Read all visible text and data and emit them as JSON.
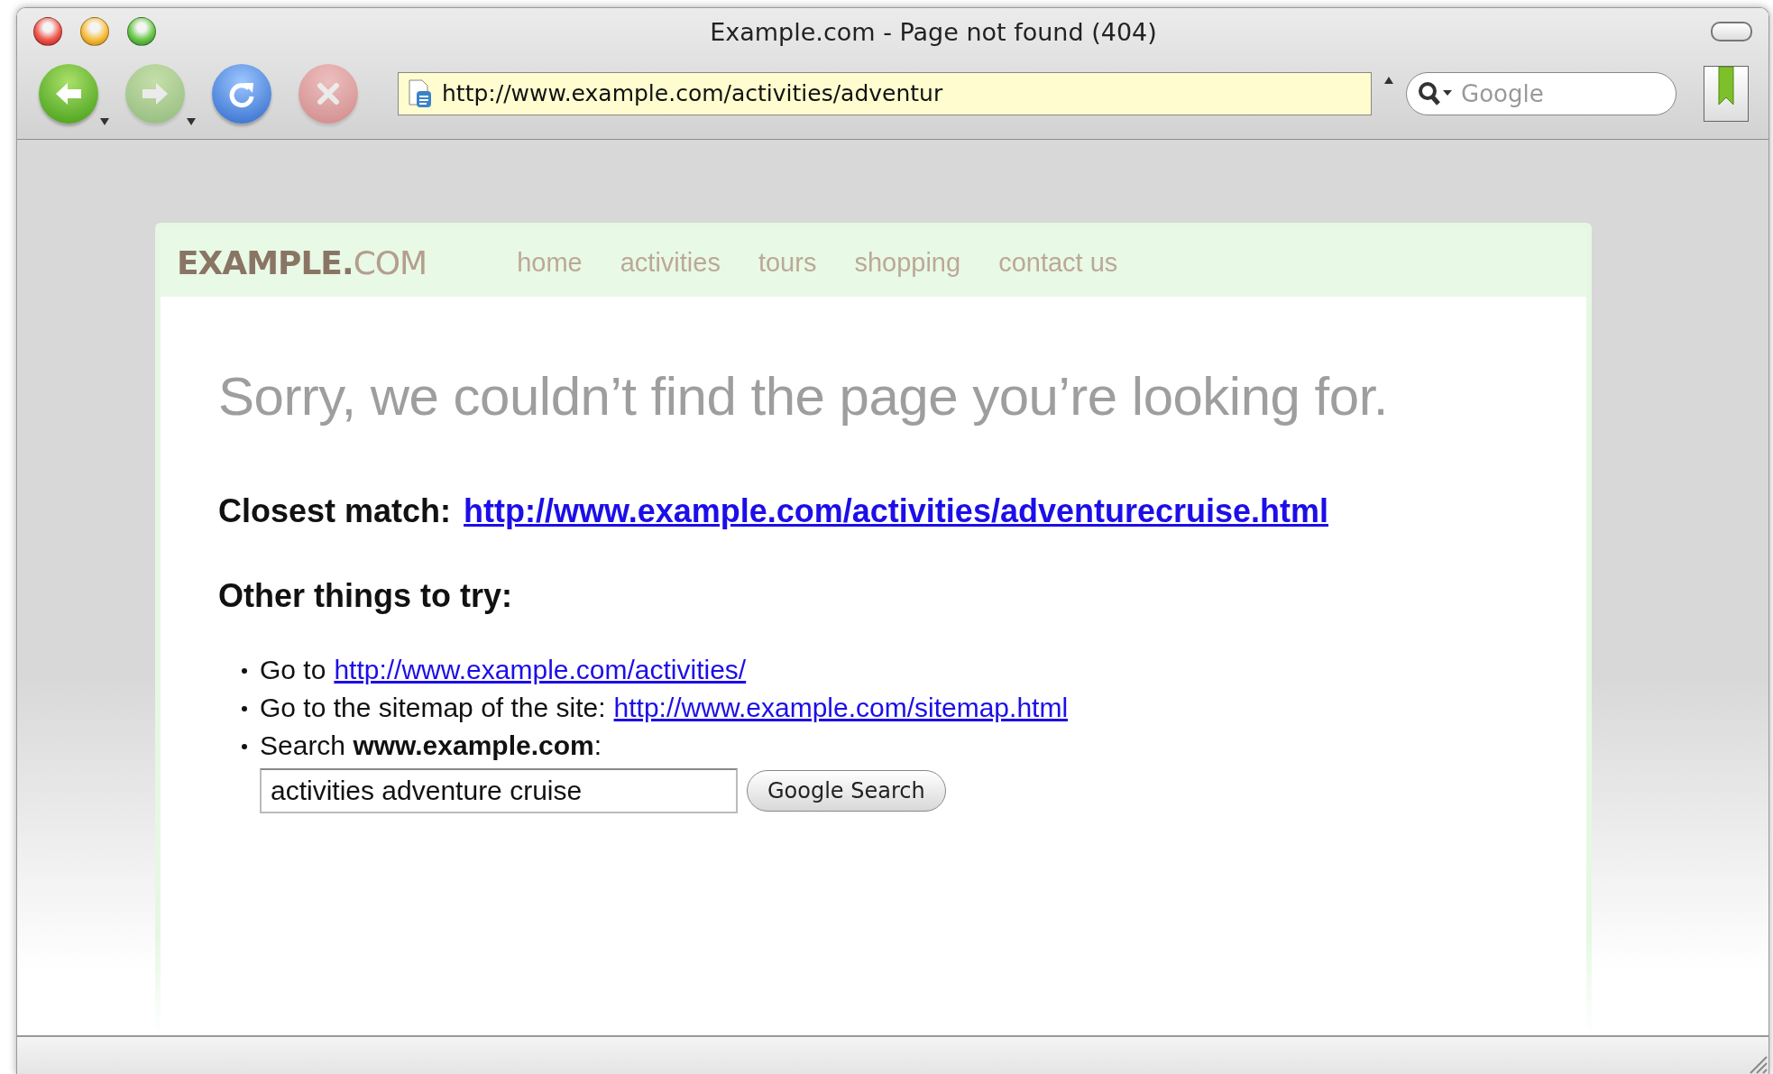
{
  "window": {
    "title": "Example.com - Page not found (404)"
  },
  "toolbar": {
    "nav_buttons": [
      {
        "kind": "back",
        "disabled": false,
        "menu": true
      },
      {
        "kind": "forward",
        "disabled": true,
        "menu": true
      },
      {
        "kind": "reload",
        "disabled": false,
        "menu": false
      },
      {
        "kind": "stop",
        "disabled": true,
        "menu": false
      }
    ],
    "address": {
      "value": "http://www.example.com/activities/adventur"
    },
    "search": {
      "placeholder": "Google"
    }
  },
  "site": {
    "logo": [
      {
        "text": "EXAMPLE.",
        "kind": "bold"
      },
      {
        "text": "COM",
        "kind": "light"
      }
    ],
    "nav": [
      "home",
      "activities",
      "tours",
      "shopping",
      "contact us"
    ]
  },
  "content": {
    "heading": "Sorry, we couldn’t find the page you’re looking for.",
    "closest_label": "Closest match:",
    "closest_link": "http://www.example.com/activities/adventurecruise.html",
    "other_heading": "Other things to try:",
    "items": [
      {
        "kind": "link",
        "text": "Go to",
        "link": "http://www.example.com/activities/"
      },
      {
        "kind": "link",
        "text": "Go to the sitemap of the site:",
        "link": "http://www.example.com/sitemap.html"
      },
      {
        "kind": "search",
        "text": "Search **www.example.com**:",
        "value": "activities adventure cruise",
        "button": "Google Search"
      }
    ]
  }
}
